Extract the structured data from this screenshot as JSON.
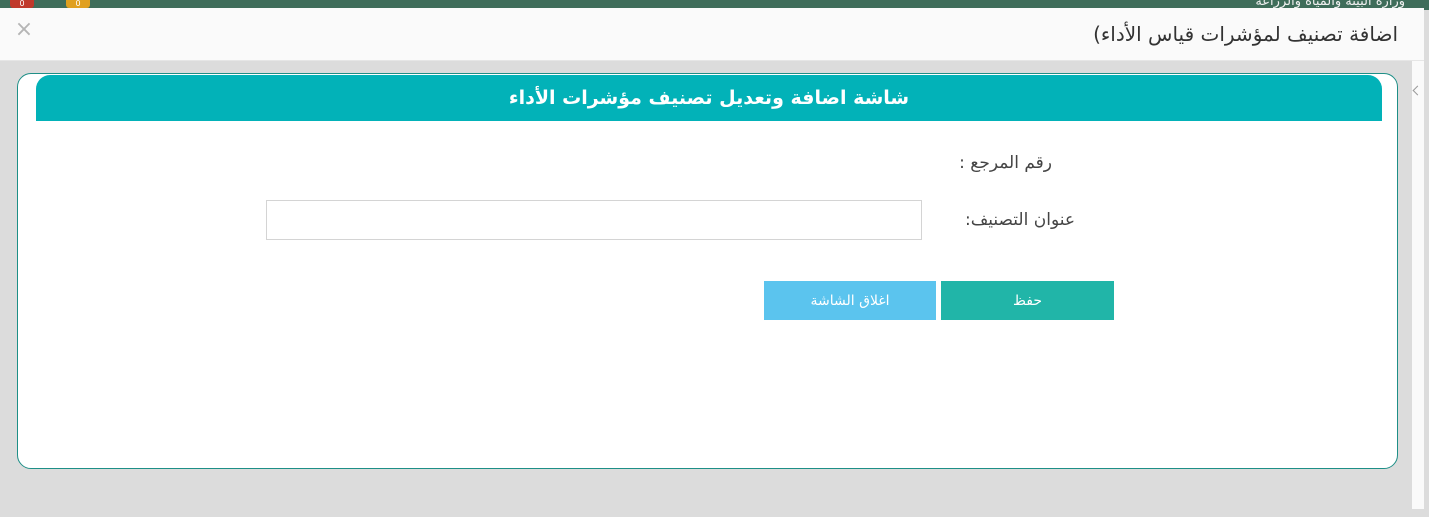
{
  "background": {
    "badge_left": "0",
    "badge_right": "0",
    "ministry_text": "وزارة البيئة والمياه والزراعة"
  },
  "modal": {
    "title": "اضافة تصنيف لمؤشرات قياس الأداء)",
    "close_glyph": "×"
  },
  "form": {
    "header": "شاشة اضافة وتعديل تصنيف مؤشرات الأداء",
    "reference_label": "رقم المرجع :",
    "reference_value": "",
    "classification_title_label": "عنوان التصنيف:",
    "classification_title_value": "",
    "save_label": "حفظ",
    "close_screen_label": "اغلاق الشاشة"
  },
  "colors": {
    "header_teal": "#02b2b8",
    "save_green": "#21b5a8",
    "close_blue": "#5bc4ee",
    "card_border": "#1e8f87"
  }
}
